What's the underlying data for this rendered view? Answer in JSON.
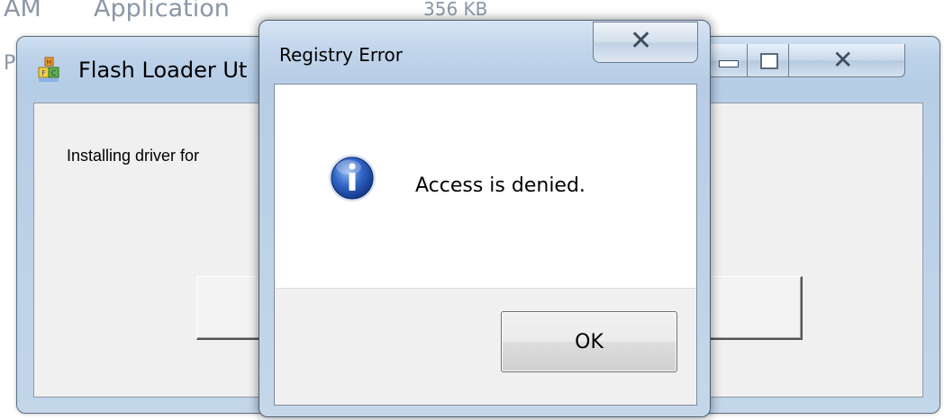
{
  "background": {
    "col_type_fragment": "AM",
    "col_name": "Application",
    "col_size_fragment": "356 KB",
    "row2_fragment": "P"
  },
  "main_window": {
    "title": "Flash Loader Ut",
    "icon": "flash-loader-app-icon",
    "status_text": "Installing driver for",
    "buttons": [
      "minimize",
      "maximize",
      "close"
    ]
  },
  "dialog": {
    "title": "Registry Error",
    "message": "Access is denied.",
    "icon": "info-icon",
    "ok_label": "OK",
    "close_glyph": "✕"
  },
  "colors": {
    "aero_frame": "#bcd2ea",
    "client_bg": "#f0f0f0",
    "info_blue": "#2a5db0"
  }
}
